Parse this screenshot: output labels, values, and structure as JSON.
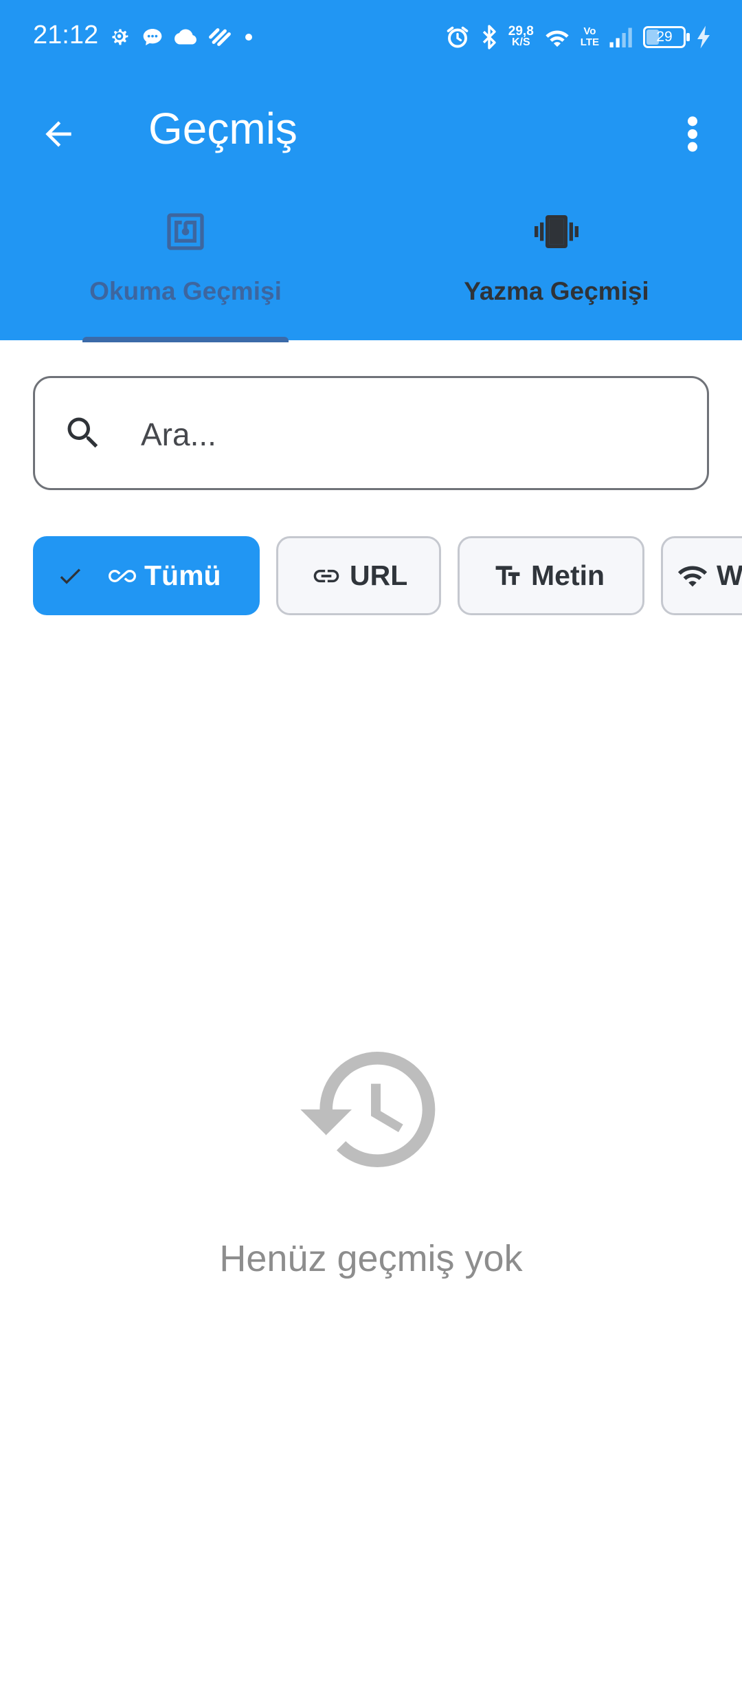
{
  "status_bar": {
    "time": "21:12",
    "net_speed_value": "29,8",
    "net_speed_unit": "K/S",
    "volte_top": "Vo",
    "volte_bottom": "LTE",
    "battery_level": "29"
  },
  "toolbar": {
    "title": "Geçmiş"
  },
  "tabs": [
    {
      "label": "Okuma Geçmişi",
      "icon": "nfc-icon",
      "selected": true
    },
    {
      "label": "Yazma Geçmişi",
      "icon": "phone-vibrate-icon",
      "selected": false
    }
  ],
  "search": {
    "placeholder": "Ara...",
    "value": ""
  },
  "filters": [
    {
      "label": "Tümü",
      "icon": "infinity-icon",
      "selected": true
    },
    {
      "label": "URL",
      "icon": "link-icon",
      "selected": false
    },
    {
      "label": "Metin",
      "icon": "text-fields-icon",
      "selected": false
    },
    {
      "label": "W",
      "icon": "wifi-icon",
      "selected": false
    }
  ],
  "empty_state": {
    "icon": "history-icon",
    "message": "Henüz geçmiş yok"
  },
  "colors": {
    "primary": "#2196F3",
    "tab_selected_text": "#3d669f",
    "tab_unselected_text": "#2f3338",
    "empty_text": "#8d8d8d"
  }
}
